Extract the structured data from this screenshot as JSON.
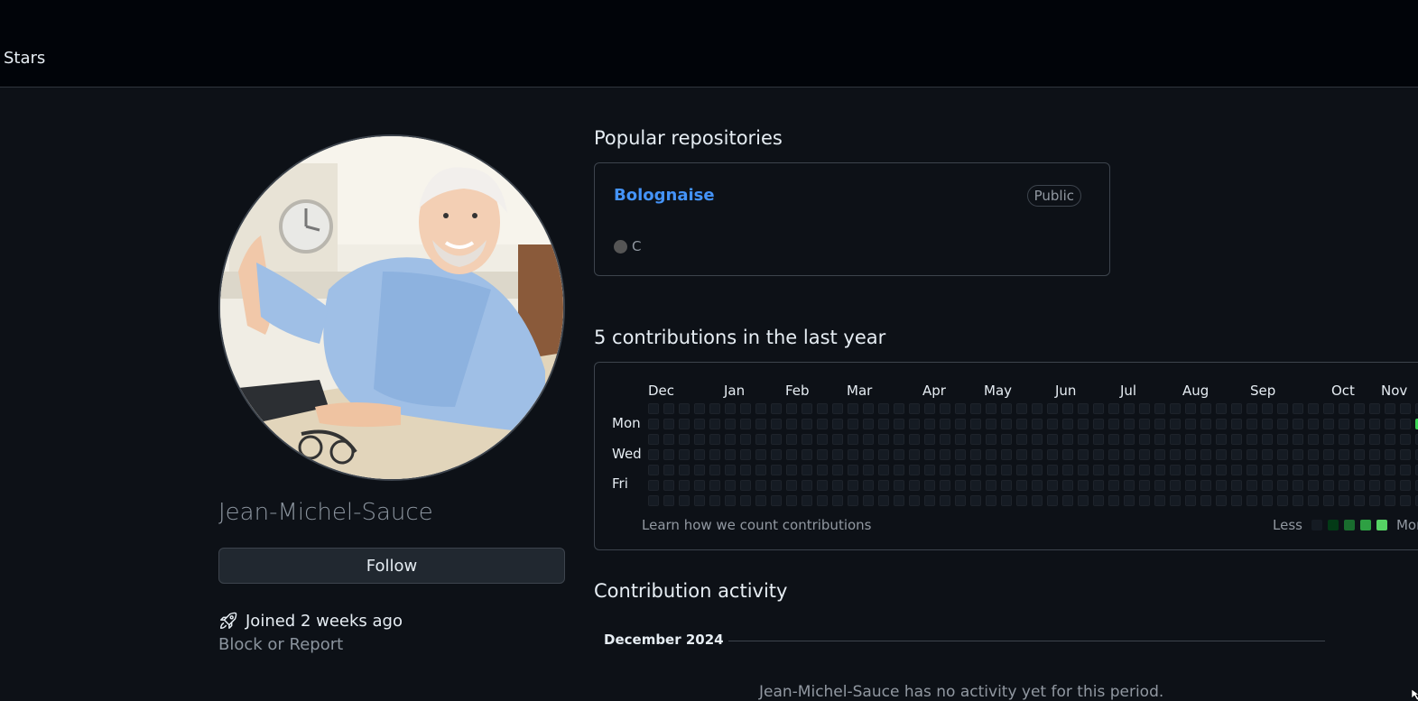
{
  "header": {
    "tab_label": "Stars"
  },
  "profile": {
    "display_name": "Jean-Michel-Sauce",
    "follow_label": "Follow",
    "joined_text": "Joined 2 weeks ago",
    "block_report_label": "Block or Report"
  },
  "popular": {
    "title": "Popular repositories",
    "repos": [
      {
        "name": "Bolognaise",
        "visibility": "Public",
        "language": "C",
        "language_color": "#555555"
      }
    ]
  },
  "contributions": {
    "title": "5 contributions in the last year",
    "months": [
      "Dec",
      "Jan",
      "Feb",
      "Mar",
      "Apr",
      "May",
      "Jun",
      "Jul",
      "Aug",
      "Sep",
      "Oct",
      "Nov"
    ],
    "days": [
      "Mon",
      "Wed",
      "Fri"
    ],
    "learn_link": "Learn how we count contributions",
    "legend_less": "Less",
    "legend_more": "More",
    "legend_colors": [
      "#151b23",
      "#033a16",
      "#196c2e",
      "#2ea043",
      "#56d364"
    ],
    "active_cell_color": "#39d353"
  },
  "activity": {
    "title": "Contribution activity",
    "month_label": "December 2024",
    "empty_text": "Jean-Michel-Sauce has no activity yet for this period."
  }
}
